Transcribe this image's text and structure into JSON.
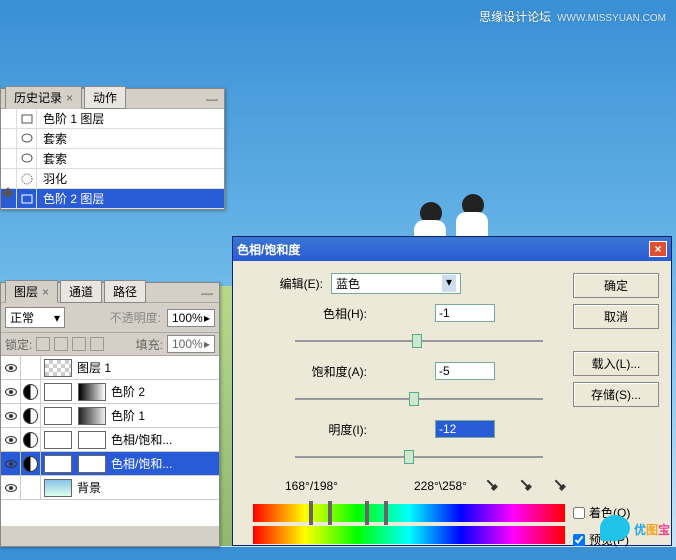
{
  "watermark": {
    "title": "思缘设计论坛",
    "url": "WWW.MISSYUAN.COM"
  },
  "history": {
    "tabs": [
      "历史记录",
      "动作"
    ],
    "items": [
      {
        "icon": "layer",
        "label": "色阶 1 图层"
      },
      {
        "icon": "lasso",
        "label": "套索"
      },
      {
        "icon": "lasso",
        "label": "套索"
      },
      {
        "icon": "feather",
        "label": "羽化"
      },
      {
        "icon": "layer",
        "label": "色阶 2 图层"
      }
    ]
  },
  "layers": {
    "tabs": [
      "图层",
      "通道",
      "路径"
    ],
    "blend": "正常",
    "opacity_lbl": "不透明度:",
    "opacity": "100%",
    "lock_lbl": "锁定:",
    "fill_lbl": "填充:",
    "fill": "100%",
    "items": [
      {
        "name": "图层 1",
        "thumb": "checker"
      },
      {
        "name": "色阶 2",
        "thumb": "grad1",
        "adj": true
      },
      {
        "name": "色阶 1",
        "thumb": "grad2",
        "adj": true
      },
      {
        "name": "色相/饱和...",
        "thumb": "white",
        "adj": true
      },
      {
        "name": "色相/饱和...",
        "thumb": "white",
        "adj": true,
        "selected": true
      },
      {
        "name": "背景",
        "thumb": "sky"
      }
    ]
  },
  "dialog": {
    "title": "色相/饱和度",
    "edit": "编辑(E):",
    "edit_val": "蓝色",
    "hue": "色相(H):",
    "hue_val": "-1",
    "sat": "饱和度(A):",
    "sat_val": "-5",
    "light": "明度(I):",
    "light_val": "-12",
    "deg1": "168°/198°",
    "deg2": "228°\\258°",
    "ok": "确定",
    "cancel": "取消",
    "load": "载入(L)...",
    "save": "存储(S)...",
    "colorize": "着色(O)",
    "preview": "预览(P)"
  },
  "brand": "优图宝"
}
